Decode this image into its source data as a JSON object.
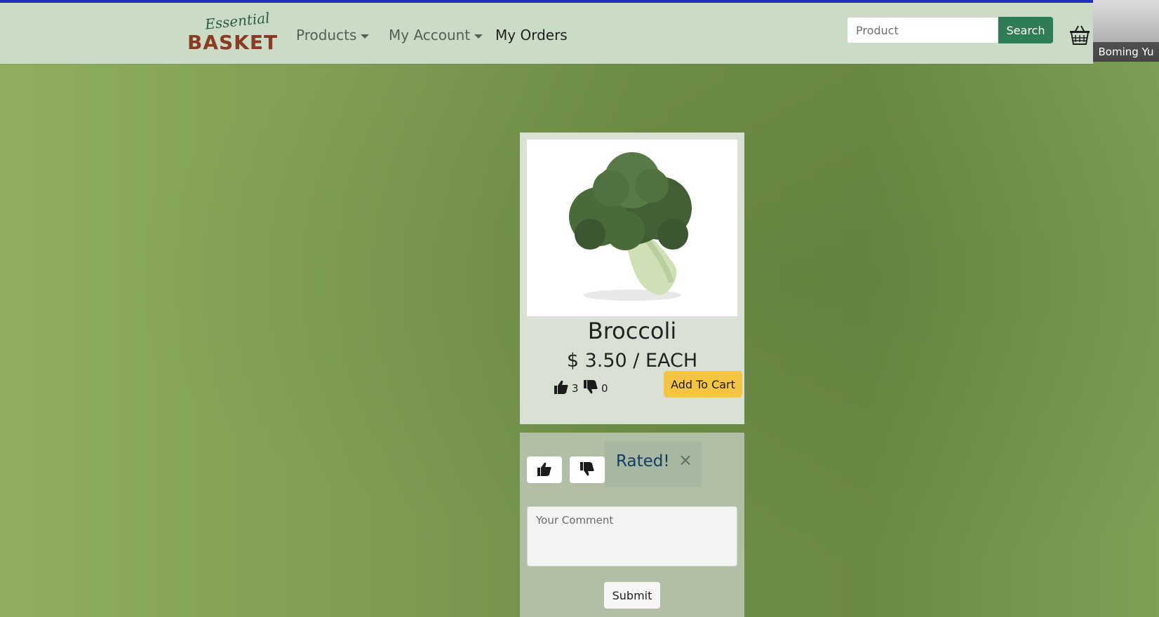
{
  "nav": {
    "brand": {
      "script": "Essential",
      "main": "BASKET"
    },
    "items": [
      {
        "label": "Products",
        "has_caret": true
      },
      {
        "label": "My Account",
        "has_caret": true
      },
      {
        "label": "My Orders",
        "has_caret": false
      }
    ],
    "search": {
      "placeholder": "Product",
      "value": "",
      "button_label": "Search"
    },
    "cart_icon": "basket-icon"
  },
  "video_overlay": {
    "name": "Boming Yu"
  },
  "product": {
    "name": "Broccoli",
    "price": "$ 3.50 / EACH",
    "likes": "3",
    "dislikes": "0",
    "add_to_cart_label": "Add To Cart",
    "image_icon": "broccoli-image"
  },
  "review": {
    "alert_text": "Rated!",
    "comment_placeholder": "Your Comment",
    "submit_label": "Submit",
    "like_icon": "thumbs-up-icon",
    "dislike_icon": "thumbs-down-icon"
  },
  "colors": {
    "nav_bg": "#cbdcc6",
    "brand_accent": "#8b3a23",
    "search_button": "#2f7d57",
    "add_to_cart": "#f5c542",
    "alert_text": "#163a68"
  }
}
